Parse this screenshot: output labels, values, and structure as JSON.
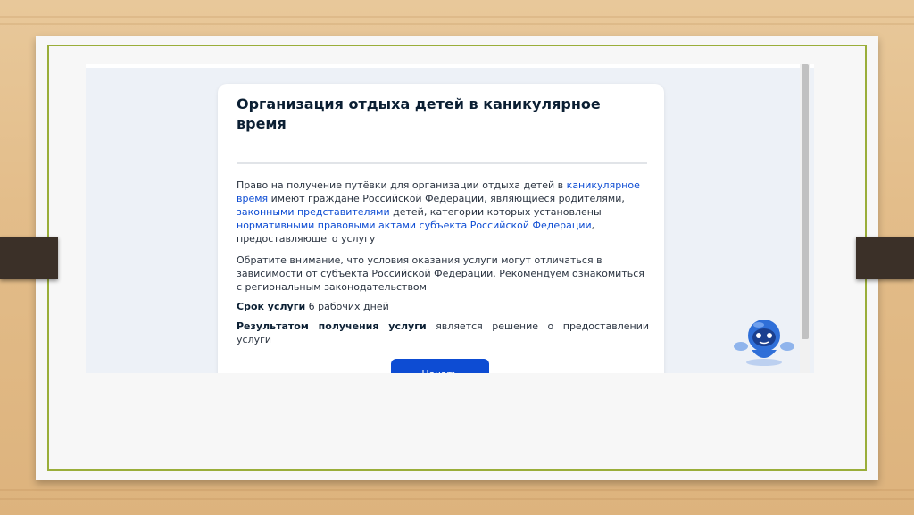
{
  "service": {
    "title": "Организация отдыха детей в каникулярное время",
    "p1": {
      "t1": "Право на получение путёвки для организации отдыха детей в ",
      "l1": "каникулярное время",
      "t2": " имеют граждане Российской Федерации, являющиеся родителями, ",
      "l2": "законными представителями",
      "t3": " детей, категории которых установлены ",
      "l3": "нормативными правовыми актами субъекта Российской Федерации",
      "t4": ", предоставляющего услугу"
    },
    "p2": "Обратите внимание, что условия оказания услуги могут отличаться в зависимости от субъекта Российской Федерации. Рекомендуем ознакомиться с региональным законодательством",
    "term_label": "Срок услуги",
    "term_value": " 6 рабочих дней",
    "result_label": "Результатом получения услуги",
    "result_text": " является решение о предоставлении услуги",
    "start_button": "Начать"
  },
  "colors": {
    "accent": "#0d4cd3",
    "frame_border": "#9aae3a",
    "background_wood": "#e3bd8a"
  },
  "icons": {
    "assistant": "robot-assistant-icon"
  }
}
